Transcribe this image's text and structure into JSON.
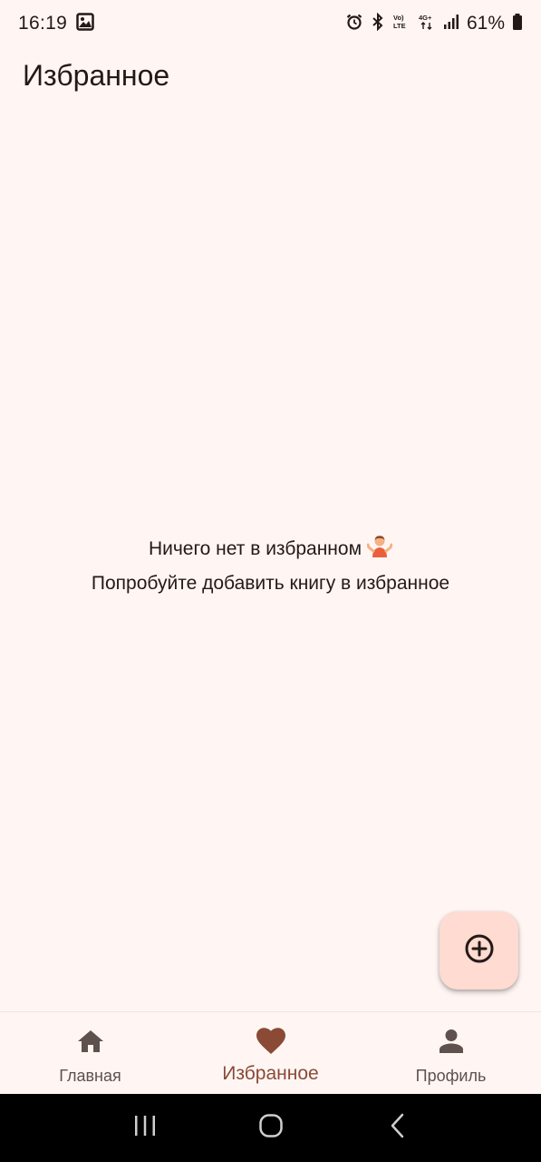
{
  "status_bar": {
    "time": "16:19",
    "battery_percent": "61%",
    "icons": [
      "gallery-icon",
      "alarm-icon",
      "bluetooth-icon",
      "volte-icon",
      "4g-icon",
      "signal-icon",
      "battery-icon"
    ]
  },
  "app_bar": {
    "title": "Избранное"
  },
  "empty_state": {
    "line1": "Ничего нет в избранном",
    "emoji": "🤷",
    "line2": "Попробуйте добавить книгу в избранное"
  },
  "fab": {
    "icon": "add-circle-icon"
  },
  "bottom_nav": {
    "items": [
      {
        "label": "Главная",
        "icon": "home-icon",
        "active": false
      },
      {
        "label": "Избранное",
        "icon": "heart-icon",
        "active": true
      },
      {
        "label": "Профиль",
        "icon": "person-icon",
        "active": false
      }
    ]
  },
  "system_nav": {
    "buttons": [
      "recents-icon",
      "home-circle-icon",
      "back-icon"
    ]
  },
  "colors": {
    "background": "#FFF6F3",
    "fab_background": "#FFDBD1",
    "active_nav": "#8B4A35",
    "inactive_nav": "#5F514D",
    "text": "#231A17"
  }
}
